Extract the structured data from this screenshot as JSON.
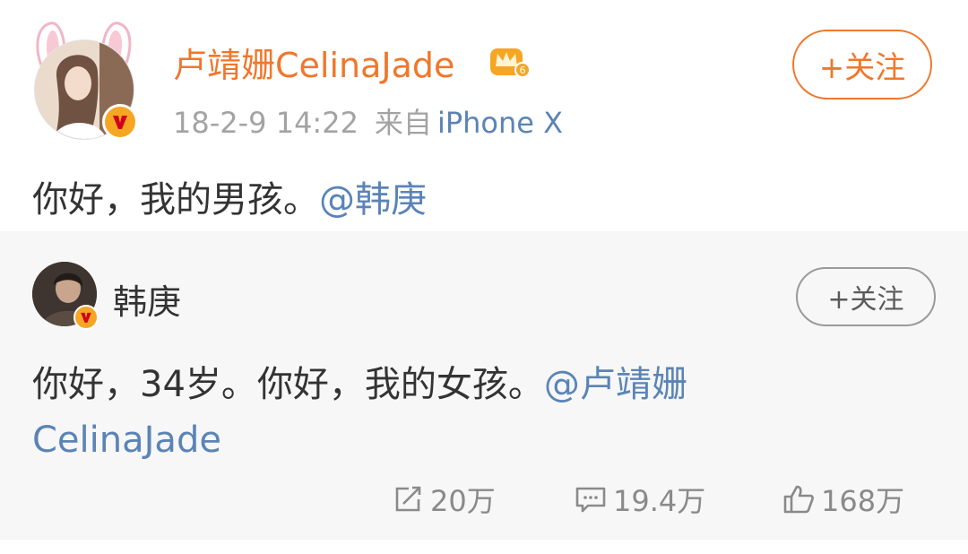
{
  "post": {
    "username": "卢靖姗CelinaJade",
    "timestamp": "18-2-9 14:22",
    "source_prefix": "来自",
    "device": "iPhone X",
    "follow_label": "+关注",
    "text": "你好，我的男孩。",
    "mention": "@韩庚"
  },
  "repost": {
    "username": "韩庚",
    "follow_label": "+关注",
    "text": "你好，34岁。你好，我的女孩。",
    "mention": "@卢靖姗CelinaJade"
  },
  "actions": {
    "repost_count": "20万",
    "comment_count": "19.4万",
    "like_count": "168万"
  },
  "colors": {
    "username": "#f0772b",
    "link": "#5b84b6",
    "meta": "#a3a3a3",
    "verified_badge": "#f5a623"
  },
  "icons": [
    "verified-v-icon",
    "crown-vip-icon",
    "repost-icon",
    "comment-icon",
    "like-icon",
    "bunny-ears-decoration"
  ]
}
